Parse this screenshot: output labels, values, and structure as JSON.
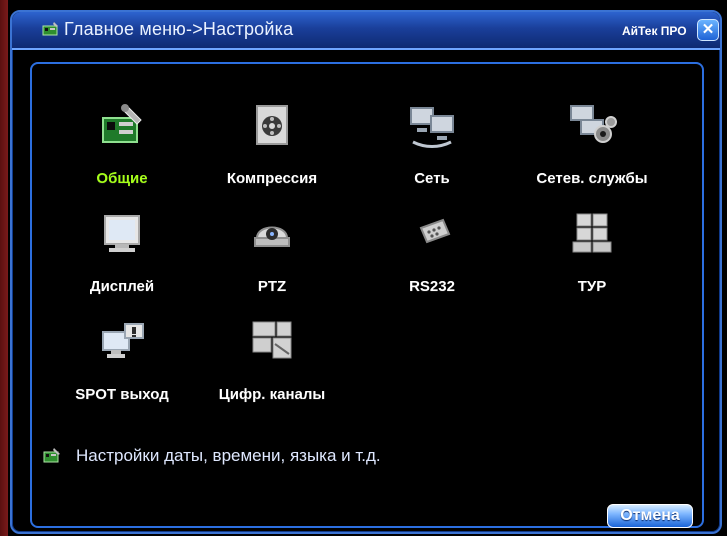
{
  "window": {
    "title": "Главное меню->Настройка",
    "brand": "АйТек ПРО",
    "close_glyph": "✕"
  },
  "tiles": [
    {
      "label": "Общие",
      "icon": "general-card-icon",
      "selected": true
    },
    {
      "label": "Компрессия",
      "icon": "compression-icon",
      "selected": false
    },
    {
      "label": "Сеть",
      "icon": "network-icon",
      "selected": false
    },
    {
      "label": "Сетев. службы",
      "icon": "network-services-icon",
      "selected": false
    },
    {
      "label": "Дисплей",
      "icon": "display-icon",
      "selected": false
    },
    {
      "label": "PTZ",
      "icon": "ptz-camera-icon",
      "selected": false
    },
    {
      "label": "RS232",
      "icon": "rs232-connector-icon",
      "selected": false
    },
    {
      "label": "ТУР",
      "icon": "tour-grid-icon",
      "selected": false
    },
    {
      "label": "SPOT выход",
      "icon": "spot-output-icon",
      "selected": false
    },
    {
      "label": "Цифр. каналы",
      "icon": "digital-channels-icon",
      "selected": false
    }
  ],
  "hint": {
    "text": "Настройки даты, времени, языка и т.д.",
    "icon": "general-card-icon"
  },
  "buttons": {
    "cancel": "Отмена"
  },
  "colors": {
    "accent": "#3b73d3",
    "selected_label": "#a6ff1a",
    "title_gradient_top": "#2d63cf"
  }
}
